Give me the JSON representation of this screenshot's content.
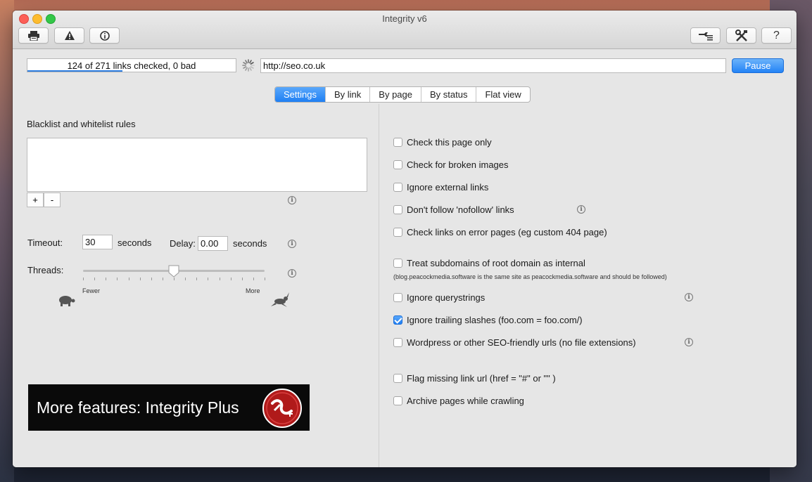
{
  "window": {
    "title": "Integrity v6"
  },
  "toolbar": {
    "left": [
      {
        "name": "print-icon"
      },
      {
        "name": "warning-icon"
      },
      {
        "name": "info-icon"
      }
    ],
    "right": [
      {
        "name": "wrench-list-icon"
      },
      {
        "name": "tools-icon"
      },
      {
        "name": "help-icon",
        "label": "?"
      }
    ]
  },
  "scan": {
    "status": "124 of 271 links checked, 0 bad",
    "progress": 0.457,
    "url": "http://seo.co.uk",
    "pause_label": "Pause"
  },
  "tabs": [
    {
      "label": "Settings",
      "active": true
    },
    {
      "label": "By link"
    },
    {
      "label": "By page"
    },
    {
      "label": "By status"
    },
    {
      "label": "Flat view"
    }
  ],
  "settings_left": {
    "rules_label": "Blacklist and whitelist rules",
    "add_label": "+",
    "remove_label": "-",
    "timeout_label": "Timeout:",
    "timeout_value": "30",
    "timeout_unit": "seconds",
    "delay_label": "Delay:",
    "delay_value": "0.00",
    "delay_unit": "seconds",
    "threads_label": "Threads:",
    "threads_level": 0.5,
    "fewer_label": "Fewer",
    "more_label": "More",
    "promo_text": "More features: Integrity Plus"
  },
  "settings_right": {
    "options": [
      {
        "label": "Check this page only",
        "checked": false
      },
      {
        "label": "Check for broken images",
        "checked": false
      },
      {
        "label": "Ignore external links",
        "checked": false
      },
      {
        "label": "Don't follow 'nofollow' links",
        "checked": false
      },
      {
        "label": "Check links on error pages (eg custom 404 page)",
        "checked": false
      },
      {
        "label": "Treat subdomains of root domain as internal",
        "checked": false
      },
      {
        "label": "Ignore querystrings",
        "checked": false
      },
      {
        "label": "Ignore trailing slashes (foo.com = foo.com/)",
        "checked": true
      },
      {
        "label": "Wordpress or other SEO-friendly urls (no file extensions)",
        "checked": false
      },
      {
        "label": "Flag missing link url (href = \"#\"  or  \"\" )",
        "checked": false
      },
      {
        "label": "Archive pages while crawling",
        "checked": false
      }
    ],
    "subdomain_note": "(blog.peacockmedia.software is the same site as peacockmedia.software and should be followed)"
  },
  "colors": {
    "accent": "#2383f6",
    "promo_bg": "#0a0a0a",
    "promo_logo": "#b01a1a"
  }
}
